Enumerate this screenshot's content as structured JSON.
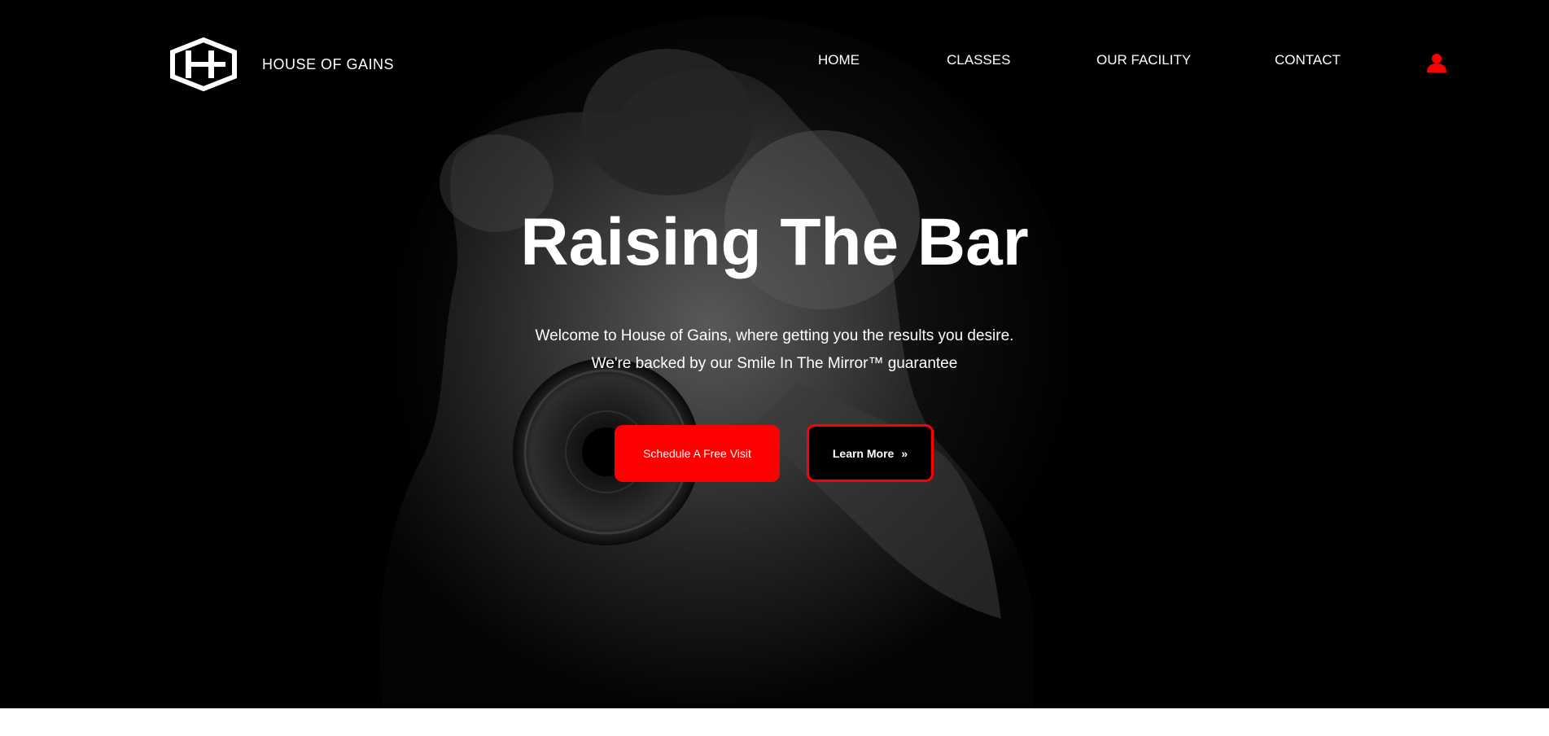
{
  "brand": {
    "name": "HOUSE OF GAINS",
    "logo_icon": "hexagon-hg-monogram-icon"
  },
  "nav": {
    "items": [
      {
        "label": "HOME"
      },
      {
        "label": "CLASSES"
      },
      {
        "label": "OUR FACILITY"
      },
      {
        "label": "CONTACT"
      }
    ],
    "user_icon": "user-account-icon"
  },
  "hero": {
    "headline": "Raising The Bar",
    "subline_1": "Welcome to House of Gains, where getting you the results you desire.",
    "subline_2": "We're backed by our Smile In The Mirror™ guarantee",
    "primary_button": "Schedule A Free Visit",
    "secondary_button": "Learn More",
    "secondary_button_icon": "»"
  },
  "colors": {
    "background": "#000000",
    "accent": "#ff0000",
    "text": "#ffffff",
    "footer_strip": "#ffffff"
  }
}
